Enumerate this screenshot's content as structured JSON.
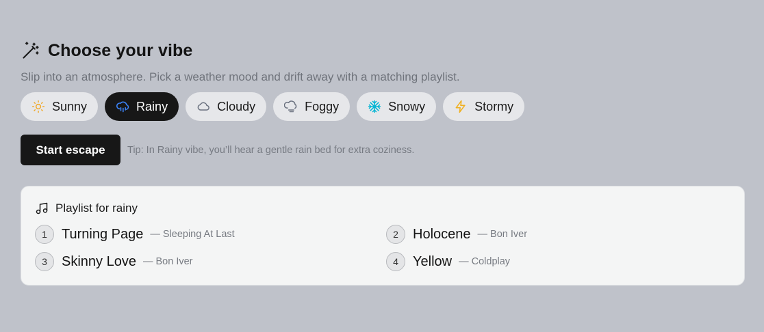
{
  "header": {
    "title": "Choose your vibe",
    "subtitle": "Slip into an atmosphere. Pick a weather mood and drift away with a matching playlist.",
    "icon": "magic-wand-icon"
  },
  "moods": [
    {
      "label": "Sunny",
      "icon": "sun-icon",
      "color": "#f0a92a",
      "active": false
    },
    {
      "label": "Rainy",
      "icon": "cloud-rain-icon",
      "color": "#3b82f6",
      "active": true
    },
    {
      "label": "Cloudy",
      "icon": "cloud-icon",
      "color": "#6b7280",
      "active": false
    },
    {
      "label": "Foggy",
      "icon": "cloud-fog-icon",
      "color": "#6b7280",
      "active": false
    },
    {
      "label": "Snowy",
      "icon": "snowflake-icon",
      "color": "#06b6d4",
      "active": false
    },
    {
      "label": "Stormy",
      "icon": "lightning-icon",
      "color": "#f0b020",
      "active": false
    }
  ],
  "actions": {
    "start_label": "Start escape",
    "tip": "Tip: In Rainy vibe, you’ll hear a gentle rain bed for extra coziness."
  },
  "playlist": {
    "heading": "Playlist for rainy",
    "icon": "music-note-icon",
    "tracks": [
      {
        "num": "1",
        "title": "Turning Page",
        "artist": "— Sleeping At Last"
      },
      {
        "num": "2",
        "title": "Holocene",
        "artist": "— Bon Iver"
      },
      {
        "num": "3",
        "title": "Skinny Love",
        "artist": "— Bon Iver"
      },
      {
        "num": "4",
        "title": "Yellow",
        "artist": "— Coldplay"
      }
    ]
  },
  "colors": {
    "background": "#bfc2ca",
    "accent_dark": "#171717",
    "card": "#f4f5f5"
  }
}
